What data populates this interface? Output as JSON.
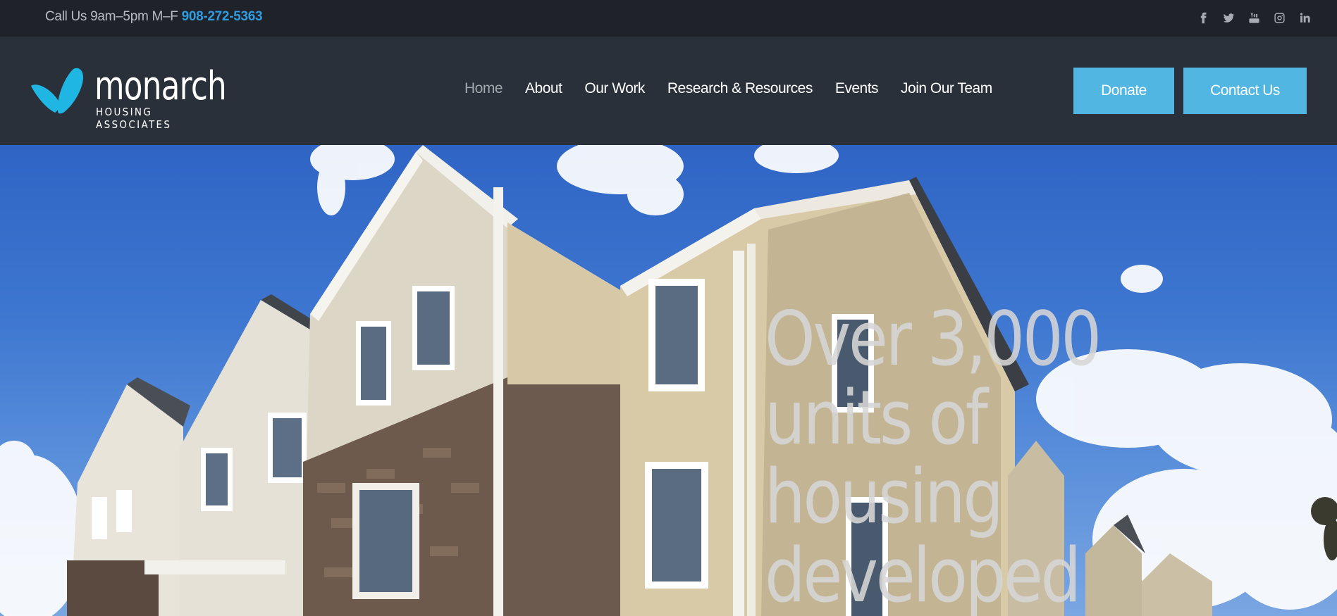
{
  "topbar": {
    "call_text": "Call Us 9am–5pm M–F",
    "phone": "908-272-5363",
    "socials": [
      {
        "icon": "facebook-icon"
      },
      {
        "icon": "twitter-icon"
      },
      {
        "icon": "youtube-icon"
      },
      {
        "icon": "instagram-icon"
      },
      {
        "icon": "linkedin-icon"
      }
    ]
  },
  "logo": {
    "word": "monarch",
    "sub": "HOUSING ASSOCIATES",
    "colors": {
      "wing": "#1fb6e3"
    }
  },
  "nav": {
    "items": [
      {
        "label": "Home",
        "active": true
      },
      {
        "label": "About"
      },
      {
        "label": "Our Work"
      },
      {
        "label": "Research & Resources"
      },
      {
        "label": "Events"
      },
      {
        "label": "Join Our Team"
      }
    ]
  },
  "actions": {
    "donate": "Donate",
    "contact": "Contact Us",
    "color": "#52b6e2"
  },
  "hero": {
    "title": "Over 3,000 units of housing developed"
  }
}
